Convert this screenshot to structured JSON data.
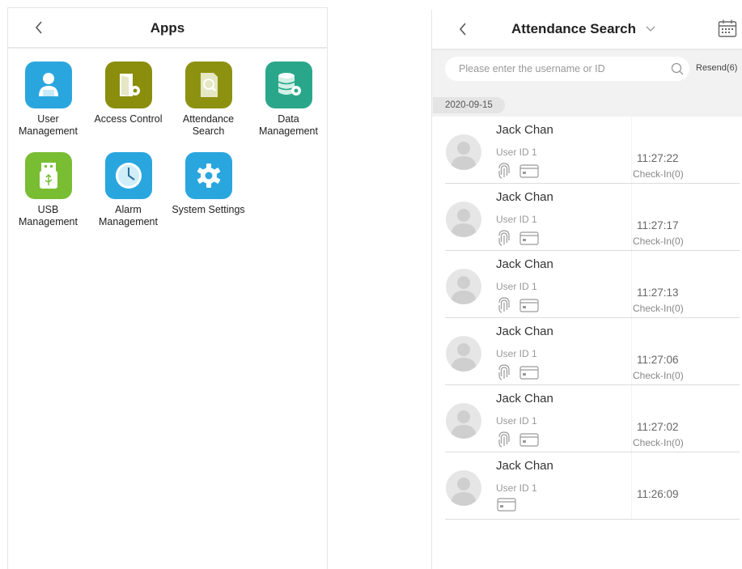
{
  "apps_screen": {
    "title": "Apps",
    "items": [
      {
        "label": "User\nManagement",
        "icon": "user-management-icon",
        "color": "#2aa6df"
      },
      {
        "label": "Access Control",
        "icon": "door-gear-icon",
        "color": "#8a8e0c"
      },
      {
        "label": "Attendance\nSearch",
        "icon": "document-search-icon",
        "color": "#8d9110"
      },
      {
        "label": "Data\nManagement",
        "icon": "database-gear-icon",
        "color": "#2aa78a"
      },
      {
        "label": "USB\nManagement",
        "icon": "usb-drive-icon",
        "color": "#79bd33"
      },
      {
        "label": "Alarm\nManagement",
        "icon": "clock-icon",
        "color": "#2aa6df"
      },
      {
        "label": "System Settings",
        "icon": "gear-icon",
        "color": "#2aa6df"
      }
    ]
  },
  "attendance_screen": {
    "title": "Attendance Search",
    "search": {
      "placeholder": "Please enter the username or ID"
    },
    "resend_label": "Resend(6)",
    "date": "2020-09-15",
    "records": [
      {
        "name": "Jack Chan",
        "user_id": "User ID 1",
        "time": "11:27:22",
        "status": "Check-In(0)",
        "fingerprint": true,
        "card": true
      },
      {
        "name": "Jack Chan",
        "user_id": "User ID 1",
        "time": "11:27:17",
        "status": "Check-In(0)",
        "fingerprint": true,
        "card": true
      },
      {
        "name": "Jack Chan",
        "user_id": "User ID 1",
        "time": "11:27:13",
        "status": "Check-In(0)",
        "fingerprint": true,
        "card": true
      },
      {
        "name": "Jack Chan",
        "user_id": "User ID 1",
        "time": "11:27:06",
        "status": "Check-In(0)",
        "fingerprint": true,
        "card": true
      },
      {
        "name": "Jack Chan",
        "user_id": "User ID 1",
        "time": "11:27:02",
        "status": "Check-In(0)",
        "fingerprint": true,
        "card": true
      },
      {
        "name": "Jack Chan",
        "user_id": "User ID 1",
        "time": "11:26:09",
        "status": "",
        "fingerprint": false,
        "card": true
      }
    ]
  }
}
